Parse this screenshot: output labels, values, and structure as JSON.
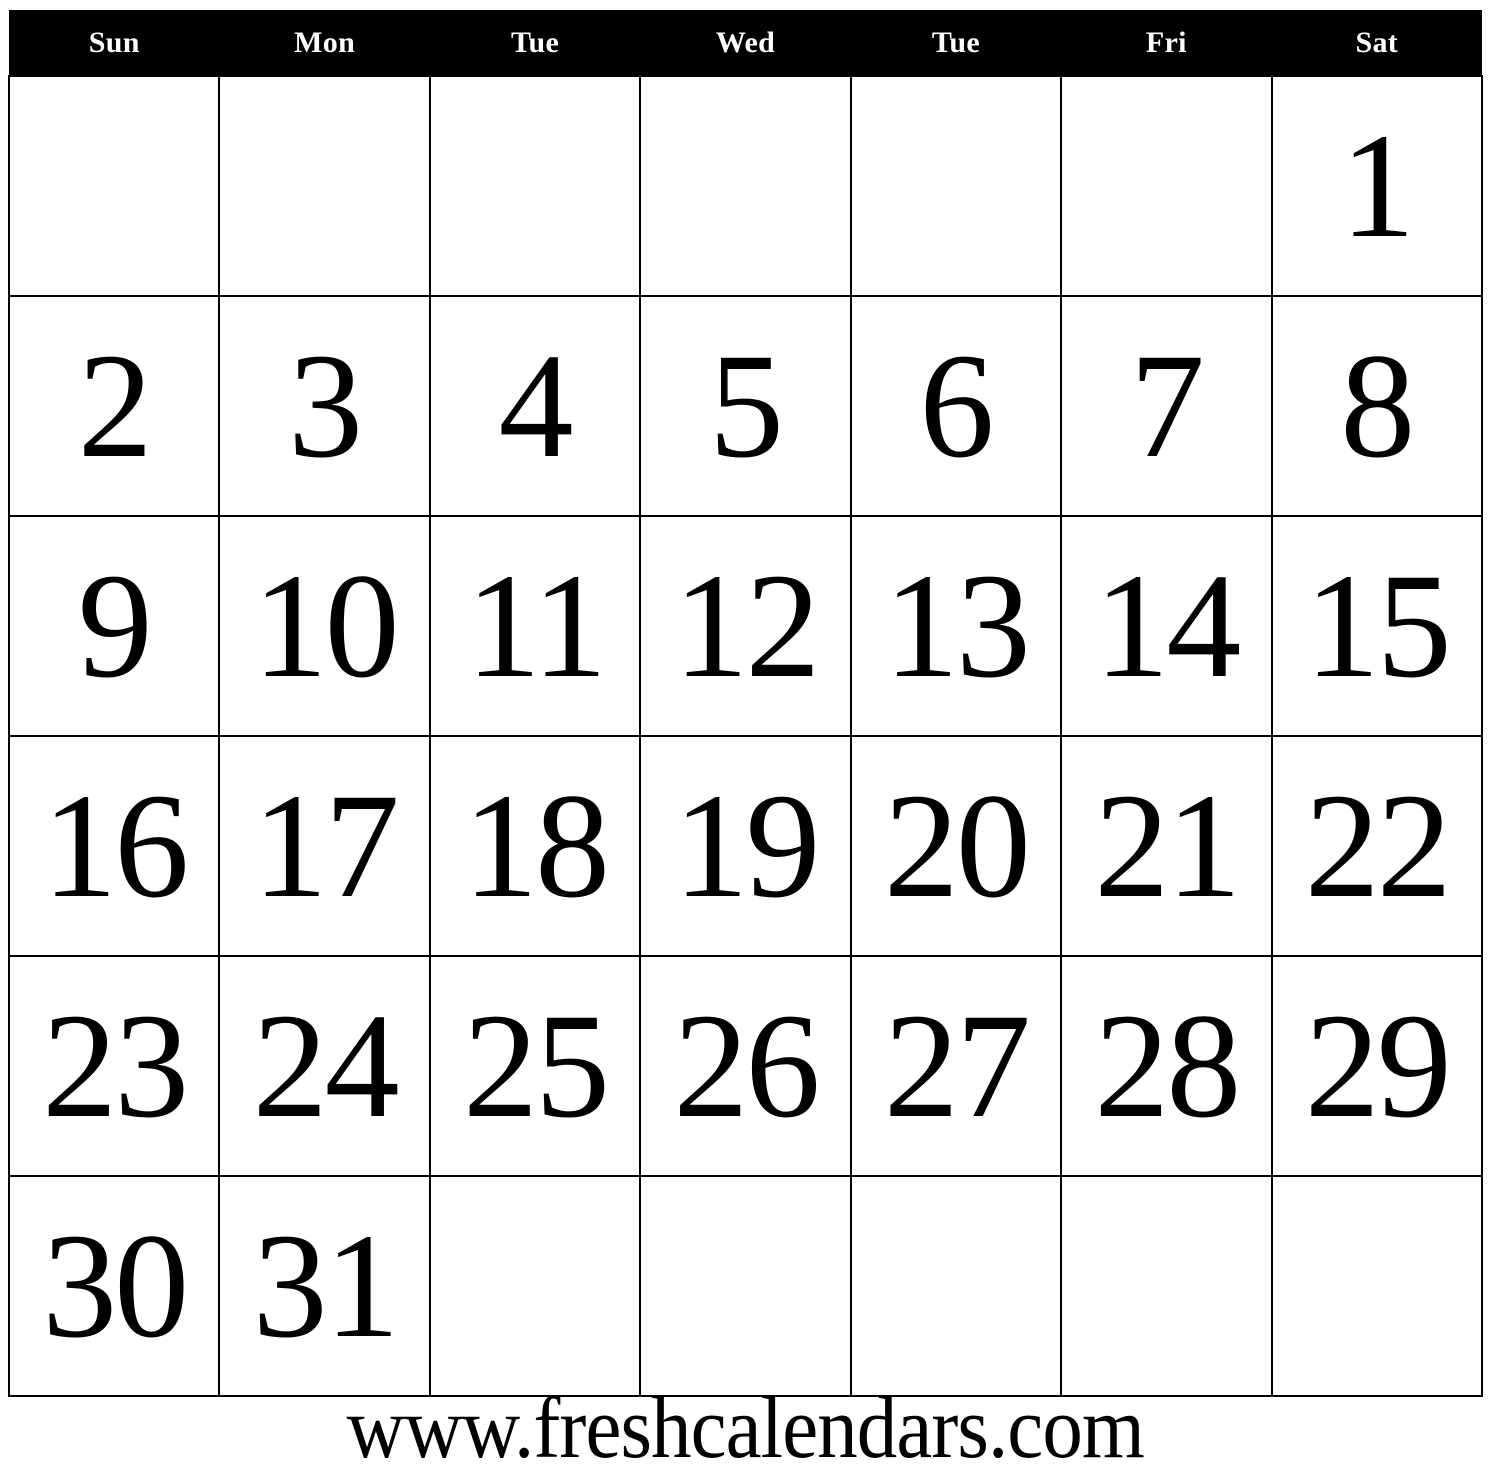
{
  "calendar": {
    "weekday_headers": [
      {
        "label": "Sun",
        "name": "sunday"
      },
      {
        "label": "Mon",
        "name": "monday"
      },
      {
        "label": "Tue",
        "name": "tuesday"
      },
      {
        "label": "Wed",
        "name": "wednesday"
      },
      {
        "label": "Tue",
        "name": "thursday"
      },
      {
        "label": "Fri",
        "name": "friday"
      },
      {
        "label": "Sat",
        "name": "saturday"
      }
    ],
    "weeks": [
      {
        "days": [
          "",
          "",
          "",
          "",
          "",
          "",
          "1"
        ]
      },
      {
        "days": [
          "2",
          "3",
          "4",
          "5",
          "6",
          "7",
          "8"
        ]
      },
      {
        "days": [
          "9",
          "10",
          "11",
          "12",
          "13",
          "14",
          "15"
        ]
      },
      {
        "days": [
          "16",
          "17",
          "18",
          "19",
          "20",
          "21",
          "22"
        ]
      },
      {
        "days": [
          "23",
          "24",
          "25",
          "26",
          "27",
          "28",
          "29"
        ]
      },
      {
        "days": [
          "30",
          "31",
          "",
          "",
          "",
          "",
          ""
        ]
      }
    ]
  },
  "footer": {
    "url": "www.freshcalendars.com"
  },
  "colors": {
    "header_background": "#000000",
    "header_text": "#ffffff",
    "grid_line": "#000000",
    "cell_background": "#ffffff",
    "day_number": "#000000",
    "footer_text": "#000000"
  }
}
